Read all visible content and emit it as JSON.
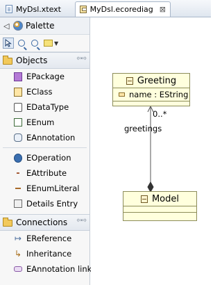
{
  "tabs": [
    {
      "label": "MyDsl.xtext",
      "icon": "xtext-file-icon"
    },
    {
      "label": "MyDsl.ecorediag",
      "icon": "ecore-diagram-icon",
      "close": "⊠"
    }
  ],
  "palette": {
    "title": "Palette",
    "collapse_arrow": "◁",
    "drawer_toggle": "⇦⇨",
    "objects": {
      "title": "Objects",
      "items": [
        {
          "label": "EPackage",
          "icon": "epackage-icon"
        },
        {
          "label": "EClass",
          "icon": "eclass-icon"
        },
        {
          "label": "EDataType",
          "icon": "edatatype-icon"
        },
        {
          "label": "EEnum",
          "icon": "eenum-icon"
        },
        {
          "label": "EAnnotation",
          "icon": "eannotation-icon"
        },
        {
          "label": "EOperation",
          "icon": "eoperation-icon"
        },
        {
          "label": "EAttribute",
          "icon": "eattribute-icon"
        },
        {
          "label": "EEnumLiteral",
          "icon": "eenumliteral-icon"
        },
        {
          "label": "Details Entry",
          "icon": "details-entry-icon"
        }
      ]
    },
    "connections": {
      "title": "Connections",
      "items": [
        {
          "label": "EReference",
          "icon": "ereference-icon"
        },
        {
          "label": "Inheritance",
          "icon": "inheritance-icon"
        },
        {
          "label": "EAnnotation link",
          "icon": "eannotation-link-icon"
        }
      ]
    }
  },
  "diagram": {
    "greeting": {
      "name": "Greeting",
      "attribute": "name : EString"
    },
    "model": {
      "name": "Model"
    },
    "reference": {
      "name": "greetings",
      "multiplicity": "0..*"
    }
  }
}
